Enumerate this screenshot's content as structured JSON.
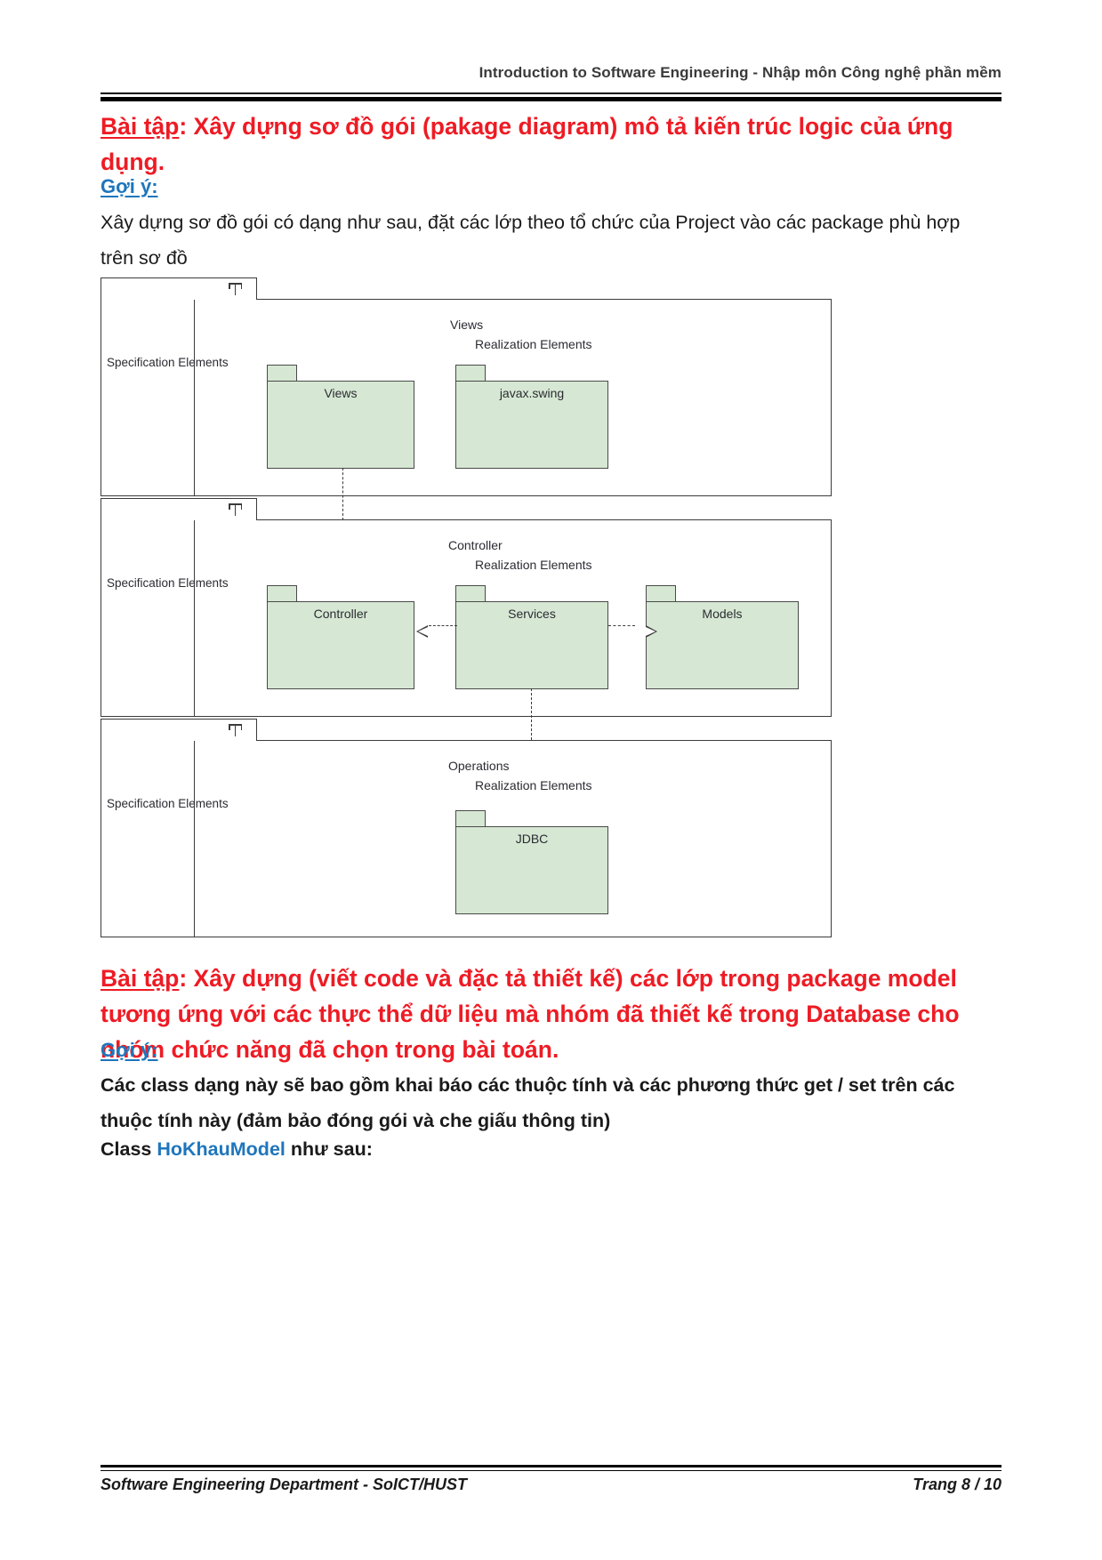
{
  "header": {
    "running_title": "Introduction to Software Engineering - Nhập môn Công nghệ phần mềm"
  },
  "exercise1": {
    "label": "Bài tập",
    "title_rest": ": Xây dựng sơ đồ gói (pakage diagram) mô tả kiến trúc logic của ứng dụng.",
    "hint_label": "Gợi ý:",
    "body": "Xây dựng sơ đồ gói có dạng như sau, đặt các lớp theo tổ chức của Project vào các package phù hợp trên sơ đồ"
  },
  "exercise2": {
    "label": "Bài tập",
    "title_rest": ": Xây dựng (viết code và đặc tả thiết kế) các lớp trong package model tương ứng với các thực thể dữ liệu mà nhóm đã thiết kế trong Database cho nhóm chức năng đã chọn trong bài toán.",
    "hint_label": "Gợi ý:",
    "body1": "Các class dạng này sẽ bao gồm khai báo các thuộc tính và các phương thức get / set trên các thuộc tính này (đảm bảo đóng gói và che giấu thông tin)",
    "body2_pre": "Class ",
    "body2_class": "HoKhauModel",
    "body2_post": " như sau:"
  },
  "diagram": {
    "type": "uml-package-diagram",
    "colors": {
      "package_fill": "#d6e8d3",
      "package_stroke": "#4a4a4a",
      "frame_stroke": "#3b3b3b"
    },
    "blocks": [
      {
        "spec_label": "Specification Elements",
        "realization_title": "Views",
        "realization_subtitle": "Realization Elements",
        "packages": [
          {
            "name": "Views"
          },
          {
            "name": "javax.swing"
          }
        ]
      },
      {
        "spec_label": "Specification Elements",
        "realization_title": "Controller",
        "realization_subtitle": "Realization Elements",
        "packages": [
          {
            "name": "Controller"
          },
          {
            "name": "Services"
          },
          {
            "name": "Models"
          }
        ]
      },
      {
        "spec_label": "Specification Elements",
        "realization_title": "Operations",
        "realization_subtitle": "Realization Elements",
        "packages": [
          {
            "name": "JDBC"
          }
        ]
      }
    ],
    "dependencies": [
      {
        "from": "Views",
        "to": "Controller",
        "style": "dashed",
        "direction": "down"
      },
      {
        "from": "Services",
        "to": "Controller",
        "style": "dashed",
        "direction": "left"
      },
      {
        "from": "Services",
        "to": "Models",
        "style": "dashed",
        "direction": "right"
      },
      {
        "from": "Services",
        "to": "JDBC",
        "style": "dashed",
        "direction": "down"
      }
    ]
  },
  "footer": {
    "department": "Software Engineering Department - SoICT/HUST",
    "page": "Trang 8 / 10"
  }
}
